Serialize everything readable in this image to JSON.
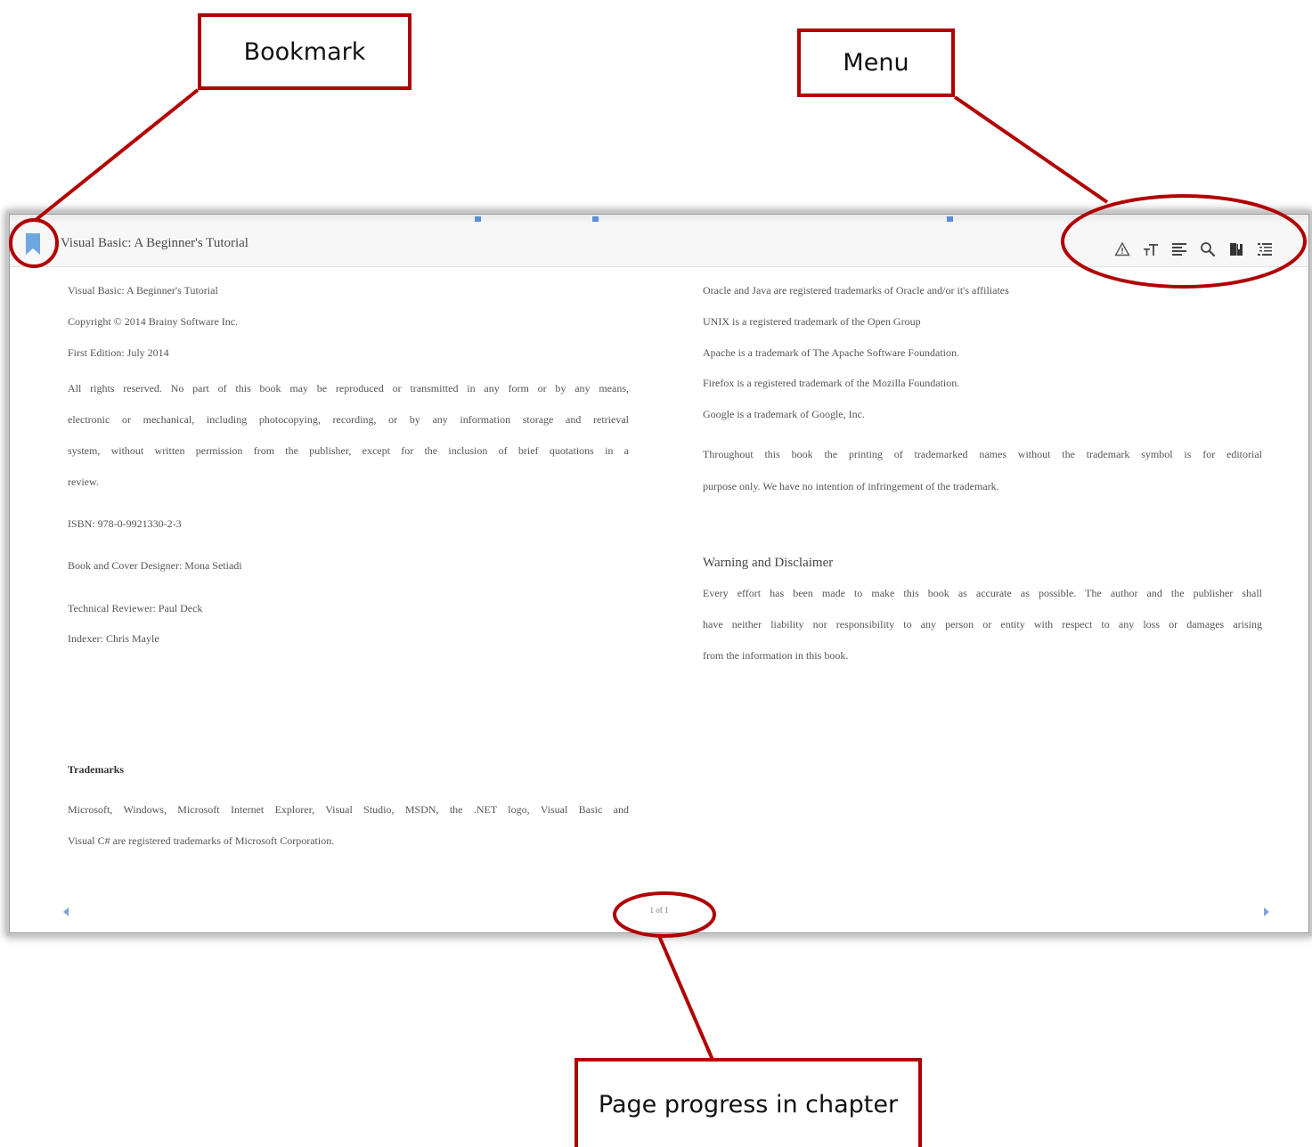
{
  "callouts": {
    "bookmark": "Bookmark",
    "menu": "Menu",
    "page_progress": "Page progress in chapter"
  },
  "reader": {
    "title": "Visual Basic: A Beginner's Tutorial",
    "menu_icons": [
      "warning-icon",
      "text-size-icon",
      "align-icon",
      "search-icon",
      "book-icon",
      "toc-list-icon"
    ],
    "accent_color": "#5b9bd5",
    "page_progress": "1 of 1"
  },
  "left_page": {
    "line1": "Visual Basic: A Beginner's Tutorial",
    "line2": "Copyright © 2014 Brainy Software Inc.",
    "line3": "First Edition: July 2014",
    "rights_lines": [
      "All rights reserved. No part of this book may be reproduced or transmitted in any form or by any means,",
      "electronic or mechanical, including photocopying, recording, or by any information storage and retrieval",
      "system, without written permission from the publisher, except for the inclusion of brief quotations in a",
      "review."
    ],
    "isbn": "ISBN: 978-0-9921330-2-3",
    "designer": "Book and Cover Designer: Mona Setiadi",
    "reviewer": "Technical Reviewer: Paul Deck",
    "indexer": "Indexer: Chris Mayle",
    "trademarks_heading": "Trademarks",
    "trademarks_lines": [
      "Microsoft, Windows, Microsoft Internet Explorer, Visual Studio, MSDN, the .NET logo, Visual Basic and",
      "Visual C# are registered trademarks of Microsoft Corporation."
    ]
  },
  "right_page": {
    "oracle": "Oracle and Java are registered trademarks of Oracle and/or it's affiliates",
    "unix": "UNIX is a registered trademark of the Open Group",
    "apache": "Apache is a trademark of The Apache Software Foundation.",
    "firefox": "Firefox is a registered trademark of the Mozilla Foundation.",
    "google": "Google is a trademark of Google, Inc.",
    "throughout_lines": [
      "Throughout this book the printing of trademarked names without the trademark symbol is for editorial",
      "purpose only. We have no intention of infringement of the trademark."
    ],
    "warning_heading": "Warning and Disclaimer",
    "warning_lines": [
      "Every effort has been made to make this book as accurate as possible. The author and the publisher shall",
      "have neither liability nor responsibility to any person or entity with respect to any loss or damages arising",
      "from the information in this book."
    ]
  }
}
